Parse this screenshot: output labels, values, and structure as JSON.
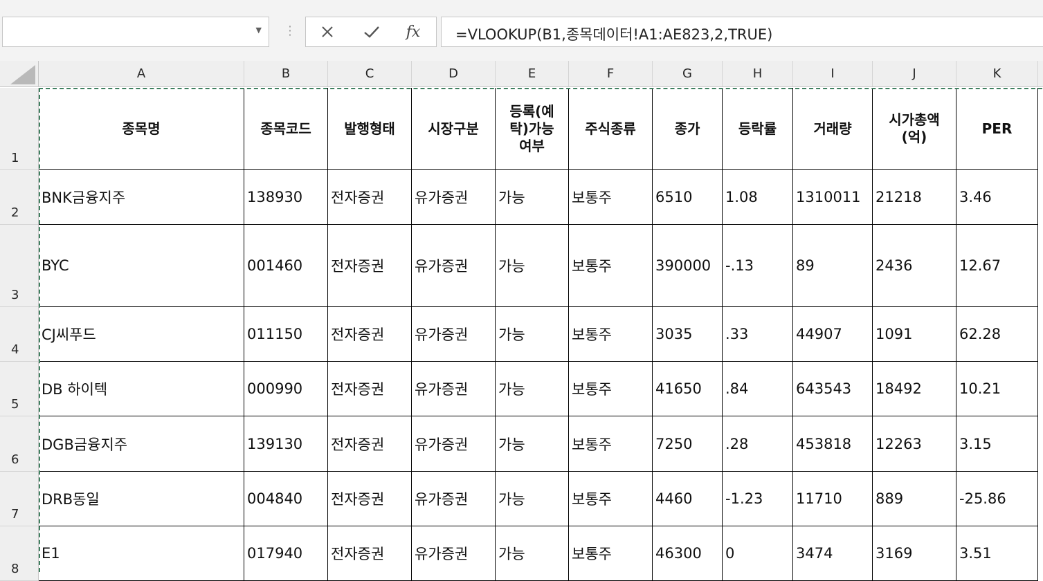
{
  "formula_bar": {
    "name_box_value": "",
    "formula": "=VLOOKUP(B1,종목데이터!A1:AE823,2,TRUE)",
    "cancel_icon": "close-icon",
    "enter_icon": "checkmark-icon",
    "function_icon": "fx-icon"
  },
  "columns": [
    "A",
    "B",
    "C",
    "D",
    "E",
    "F",
    "G",
    "H",
    "I",
    "J",
    "K"
  ],
  "rows": [
    "1",
    "2",
    "3",
    "4",
    "5",
    "6",
    "7",
    "8"
  ],
  "header_row": [
    "종목명",
    "종목코드",
    "발행형태",
    "시장구분",
    "등록(예\n탁)가능\n여부",
    "주식종류",
    "종가",
    "등락률",
    "거래량",
    "시가총액\n(억)",
    "PER"
  ],
  "data_rows": [
    [
      "BNK금융지주",
      "138930",
      "전자증권",
      "유가증권",
      "가능",
      "보통주",
      "6510",
      "1.08",
      "1310011",
      "21218",
      "3.46"
    ],
    [
      "BYC",
      "001460",
      "전자증권",
      "유가증권",
      "가능",
      "보통주",
      "390000",
      "-.13",
      "89",
      "2436",
      "12.67"
    ],
    [
      "CJ씨푸드",
      "011150",
      "전자증권",
      "유가증권",
      "가능",
      "보통주",
      "3035",
      ".33",
      "44907",
      "1091",
      "62.28"
    ],
    [
      "DB 하이텍",
      "000990",
      "전자증권",
      "유가증권",
      "가능",
      "보통주",
      "41650",
      ".84",
      "643543",
      "18492",
      "10.21"
    ],
    [
      "DGB금융지주",
      "139130",
      "전자증권",
      "유가증권",
      "가능",
      "보통주",
      "7250",
      ".28",
      "453818",
      "12263",
      "3.15"
    ],
    [
      "DRB동일",
      "004840",
      "전자증권",
      "유가증권",
      "가능",
      "보통주",
      "4460",
      "-1.23",
      "11710",
      "889",
      "-25.86"
    ],
    [
      "E1",
      "017940",
      "전자증권",
      "유가증권",
      "가능",
      "보통주",
      "46300",
      "0",
      "3474",
      "3169",
      "3.51"
    ]
  ],
  "colors": {
    "marquee": "#3f7f5f",
    "header_bg": "#efefef",
    "cell_border": "#000000"
  }
}
